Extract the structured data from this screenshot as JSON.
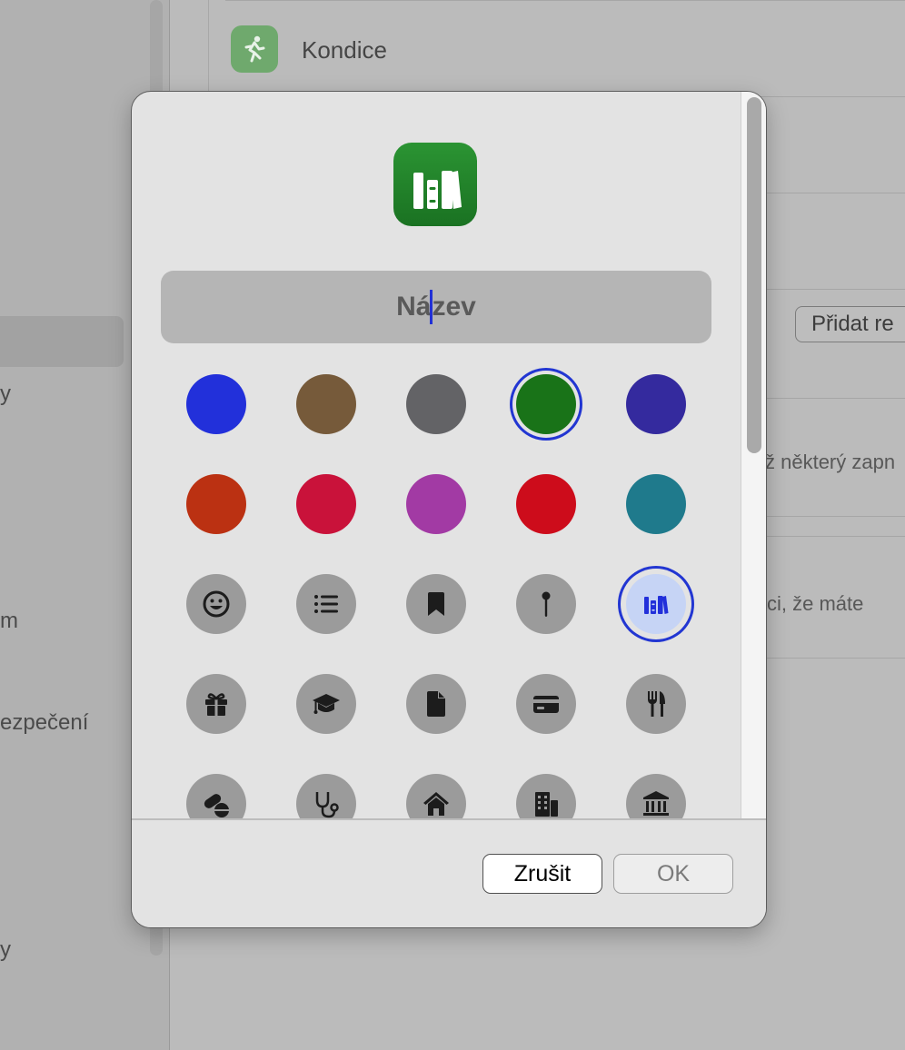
{
  "background": {
    "kondice_label": "Kondice",
    "add_button_label": "Přidat re",
    "sidebar_fragments": [
      "y",
      "m",
      "ezpečení",
      "y"
    ],
    "content_fragments": [
      "ž některý zapn",
      "ci, že máte"
    ]
  },
  "dialog": {
    "name_field": {
      "placeholder_before_caret": "Ná",
      "placeholder_after_caret": "zev"
    },
    "colors": [
      [
        "#2230da",
        "#765a3a",
        "#636366",
        "#197318",
        "#342a9e"
      ],
      [
        "#bb3112",
        "#c9123a",
        "#a23aa4",
        "#cd0c1b",
        "#1f7a8c"
      ]
    ],
    "selected_color": "#197318",
    "icons": [
      [
        "smiley-icon",
        "list-icon",
        "bookmark-icon",
        "pin-icon",
        "books-icon"
      ],
      [
        "gift-icon",
        "graduation-cap-icon",
        "document-icon",
        "credit-card-icon",
        "fork-knife-icon"
      ],
      [
        "pills-icon",
        "stethoscope-icon",
        "house-icon",
        "building-icon",
        "bank-icon"
      ]
    ],
    "selected_icon": "books-icon",
    "buttons": {
      "cancel": "Zrušit",
      "ok": "OK"
    }
  }
}
